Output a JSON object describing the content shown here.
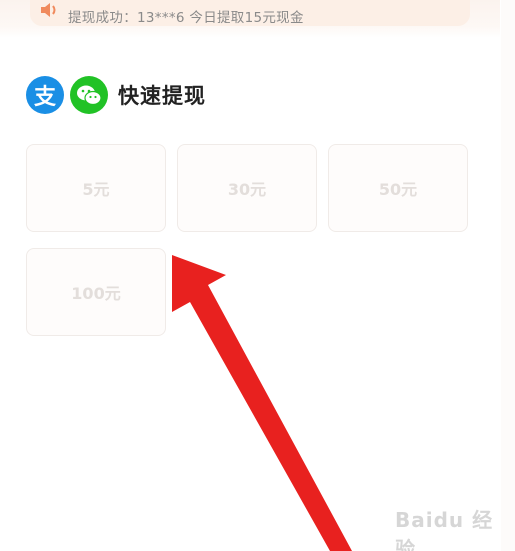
{
  "notice": {
    "text": "提现成功：13***6 今日提取15元现金",
    "icon": "speaker-icon"
  },
  "withdraw": {
    "title": "快速提现",
    "methods": [
      {
        "name": "alipay",
        "glyph": "支",
        "color": "#1a8fe5"
      },
      {
        "name": "wechat",
        "color": "#21c226"
      }
    ],
    "amounts": [
      "5元",
      "30元",
      "50元",
      "100元"
    ]
  },
  "annotation": {
    "arrow_color": "#e8211f"
  },
  "watermark": {
    "text": "Baidu 经验"
  }
}
